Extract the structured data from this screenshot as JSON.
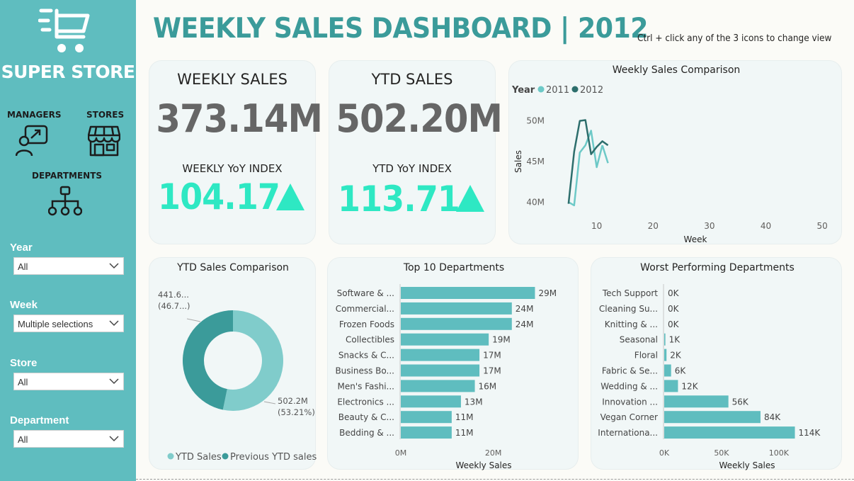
{
  "sidebar": {
    "store_name": "SUPER STORE",
    "nav": [
      {
        "label": "MANAGERS",
        "icon": "manager-icon"
      },
      {
        "label": "STORES",
        "icon": "store-icon"
      },
      {
        "label": "DEPARTMENTS",
        "icon": "department-hierarchy-icon"
      }
    ],
    "filters": [
      {
        "label": "Year",
        "value": "All"
      },
      {
        "label": "Week",
        "value": "Multiple selections"
      },
      {
        "label": "Store",
        "value": "All"
      },
      {
        "label": "Department",
        "value": "All"
      }
    ]
  },
  "header": {
    "title": "WEEKLY SALES DASHBOARD | 2012",
    "hint": "Ctrl + click any of the 3 icons to change view"
  },
  "kpis": {
    "weekly": {
      "title": "WEEKLY SALES",
      "value": "373.14M",
      "index_label": "WEEKLY YoY INDEX",
      "index_value": "104.17",
      "trend": "up"
    },
    "ytd": {
      "title": "YTD SALES",
      "value": "502.20M",
      "index_label": "YTD YoY INDEX",
      "index_value": "113.71",
      "trend": "up"
    }
  },
  "colors": {
    "accent": "#3b9b9a",
    "sidebar": "#5fbdbf",
    "index": "#2ee8c3",
    "series_2011": "#6dc9c7",
    "series_2012": "#2d6e6c",
    "bar": "#5fbdbf",
    "donut_ytd": "#80cccb",
    "donut_prev": "#3b9b9a"
  },
  "chart_data": [
    {
      "type": "line",
      "title": "Weekly Sales Comparison",
      "xlabel": "Week",
      "ylabel": "Sales",
      "legend_title": "Year",
      "xticks": [
        "10",
        "20",
        "30",
        "40",
        "50"
      ],
      "yticks": [
        "40M",
        "45M",
        "50M"
      ],
      "xlim": [
        1,
        53
      ],
      "ylim": [
        37.5,
        52.5
      ],
      "series": [
        {
          "name": "2011",
          "x": [
            5,
            6,
            7,
            8,
            9,
            10,
            11
          ],
          "values": [
            40.0,
            39.6,
            46.1,
            47.0,
            48.8,
            44.3,
            47.0
          ]
        },
        {
          "name": "2011",
          "x": [
            11,
            12
          ],
          "values": [
            47.0,
            44.8
          ]
        },
        {
          "name": "2012",
          "x": [
            5,
            6,
            7,
            8,
            9,
            10,
            11,
            12
          ],
          "values": [
            39.8,
            46.2,
            50.0,
            50.1,
            45.9,
            46.8,
            47.5,
            47.0
          ]
        }
      ]
    },
    {
      "type": "pie",
      "title": "YTD Sales Comparison",
      "donut": true,
      "slices": [
        {
          "name": "YTD Sales",
          "value": 502.2,
          "label": "502.2M",
          "pct": "(53.21%)"
        },
        {
          "name": "Previous YTD sales",
          "value": 441.6,
          "label": "441.6...",
          "pct": "(46.7...)"
        }
      ]
    },
    {
      "type": "bar",
      "orientation": "horizontal",
      "title": "Top 10 Departments",
      "xlabel": "Weekly Sales",
      "xticks": [
        "0M",
        "20M"
      ],
      "xlim": [
        0,
        30
      ],
      "categories": [
        "Software & ...",
        "Commercial...",
        "Frozen Foods",
        "Collectibles",
        "Snacks & C...",
        "Business Bo...",
        "Men's Fashi...",
        "Electronics ...",
        "Beauty & C...",
        "Bedding & ..."
      ],
      "values": [
        29,
        24,
        24,
        19,
        17,
        17,
        16,
        13,
        11,
        11
      ],
      "labels": [
        "29M",
        "24M",
        "24M",
        "19M",
        "17M",
        "17M",
        "16M",
        "13M",
        "11M",
        "11M"
      ]
    },
    {
      "type": "bar",
      "orientation": "horizontal",
      "title": "Worst Performing Departments",
      "xlabel": "Weekly Sales",
      "xticks": [
        "0K",
        "50K",
        "100K"
      ],
      "xlim": [
        0,
        118
      ],
      "categories": [
        "Tech Support",
        "Cleaning Su...",
        "Knitting & ...",
        "Seasonal",
        "Floral",
        "Fabric & Se...",
        "Wedding & ...",
        "Innovation ...",
        "Vegan Corner",
        "Internationa..."
      ],
      "values": [
        0,
        0,
        0,
        1,
        2,
        6,
        12,
        56,
        84,
        114
      ],
      "labels": [
        "0K",
        "0K",
        "0K",
        "1K",
        "2K",
        "6K",
        "12K",
        "56K",
        "84K",
        "114K"
      ]
    }
  ]
}
